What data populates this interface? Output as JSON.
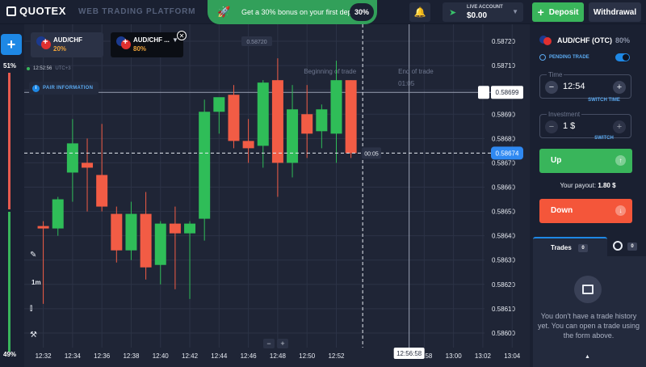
{
  "header": {
    "logo_text": "QUOTEX",
    "platform_title": "WEB TRADING PLATFORM",
    "bonus": {
      "text": "Get a 30% bonus on your first deposit",
      "badge": "30%"
    },
    "account": {
      "label": "LIVE ACCOUNT",
      "balance": "$0.00"
    },
    "deposit_label": "Deposit",
    "withdrawal_label": "Withdrawal"
  },
  "left_rail": {
    "add_label": "+",
    "sentiment_up": "51%",
    "sentiment_down": "49%",
    "sentiment_up_value": 51
  },
  "asset_tabs": [
    {
      "name": "AUD/CHF",
      "payout": "20%"
    },
    {
      "name": "AUD/CHF ...",
      "payout": "80%"
    }
  ],
  "chart_header": {
    "time": "12:52:56",
    "timezone": "UTC+3",
    "pair_info": "PAIR INFORMATION"
  },
  "tools": {
    "timeframe": "1m"
  },
  "zoom": {
    "minus": "−",
    "plus": "+"
  },
  "chart_data": {
    "type": "candlestick",
    "title": "",
    "xlabel": "",
    "ylabel": "",
    "ylim": [
      0.58594,
      0.58727
    ],
    "y_ticks": [
      "0.58720",
      "0.58710",
      "0.58700",
      "0.58690",
      "0.58680",
      "0.58670",
      "0.58660",
      "0.58650",
      "0.58640",
      "0.58630",
      "0.58620",
      "0.58610",
      "0.58600"
    ],
    "x_ticks": [
      "12:32",
      "12:34",
      "12:36",
      "12:38",
      "12:40",
      "12:42",
      "12:44",
      "12:46",
      "12:48",
      "12:50",
      "12:52",
      "12:56:58",
      "12:58",
      "13:00",
      "13:02",
      "13:04"
    ],
    "x_tick_minutes": [
      32,
      34,
      36,
      38,
      40,
      42,
      44,
      46,
      48,
      50,
      52,
      56.97,
      58,
      60,
      62,
      64
    ],
    "candles": [
      {
        "t": 32,
        "o": 0.58644,
        "h": 0.58646,
        "l": 0.58612,
        "c": 0.58643
      },
      {
        "t": 33,
        "o": 0.58643,
        "h": 0.58656,
        "l": 0.5864,
        "c": 0.58655
      },
      {
        "t": 34,
        "o": 0.58666,
        "h": 0.58688,
        "l": 0.58654,
        "c": 0.58678
      },
      {
        "t": 35,
        "o": 0.5867,
        "h": 0.5868,
        "l": 0.5865,
        "c": 0.58668
      },
      {
        "t": 36,
        "o": 0.58665,
        "h": 0.58686,
        "l": 0.5865,
        "c": 0.58652
      },
      {
        "t": 37,
        "o": 0.58649,
        "h": 0.58652,
        "l": 0.58629,
        "c": 0.58634
      },
      {
        "t": 38,
        "o": 0.58634,
        "h": 0.58654,
        "l": 0.5863,
        "c": 0.58649
      },
      {
        "t": 39,
        "o": 0.58649,
        "h": 0.58658,
        "l": 0.58622,
        "c": 0.58627
      },
      {
        "t": 40,
        "o": 0.58628,
        "h": 0.58646,
        "l": 0.5862,
        "c": 0.58645
      },
      {
        "t": 41,
        "o": 0.58645,
        "h": 0.58652,
        "l": 0.58618,
        "c": 0.58641
      },
      {
        "t": 42,
        "o": 0.58641,
        "h": 0.58646,
        "l": 0.58614,
        "c": 0.58645
      },
      {
        "t": 43,
        "o": 0.58647,
        "h": 0.58696,
        "l": 0.58638,
        "c": 0.58691
      },
      {
        "t": 44,
        "o": 0.58691,
        "h": 0.58696,
        "l": 0.58682,
        "c": 0.58697
      },
      {
        "t": 45,
        "o": 0.58698,
        "h": 0.58702,
        "l": 0.58676,
        "c": 0.58679
      },
      {
        "t": 46,
        "o": 0.58679,
        "h": 0.58688,
        "l": 0.5867,
        "c": 0.58676
      },
      {
        "t": 47,
        "o": 0.58677,
        "h": 0.58704,
        "l": 0.58668,
        "c": 0.58703
      },
      {
        "t": 48,
        "o": 0.58704,
        "h": 0.58713,
        "l": 0.58656,
        "c": 0.5867
      },
      {
        "t": 49,
        "o": 0.5867,
        "h": 0.58702,
        "l": 0.58664,
        "c": 0.58692
      },
      {
        "t": 50,
        "o": 0.5869,
        "h": 0.58702,
        "l": 0.58672,
        "c": 0.58682
      },
      {
        "t": 51,
        "o": 0.58683,
        "h": 0.58694,
        "l": 0.58676,
        "c": 0.58692
      },
      {
        "t": 52,
        "o": 0.58682,
        "h": 0.58712,
        "l": 0.5867,
        "c": 0.58704
      },
      {
        "t": 53,
        "o": 0.58704,
        "h": 0.58704,
        "l": 0.58672,
        "c": 0.58674
      }
    ],
    "current_price": "0.58674",
    "current_price_value": 0.58674,
    "strike_price": "0.58699",
    "strike_price_value": 0.58699,
    "hover_price": "0.58720",
    "hover_price_value": 0.5872,
    "countdown": "00:05",
    "beginning_label": "Beginning of trade",
    "end_label": "End of trade",
    "end_time": "01:05",
    "beginning_time_value": 53.8,
    "end_time_value": 56.97,
    "x_range": [
      30.7,
      65.2
    ],
    "colors": {
      "up": "#2fbd58",
      "down": "#f25c45",
      "grid": "#2c3346",
      "price_badge": "#2f89f2"
    }
  },
  "panel": {
    "asset": "AUD/CHF (OTC)",
    "payout_pct": "80%",
    "pending_label": "PENDING TRADE",
    "time_label": "Time",
    "time_value": "12:54",
    "switch_time": "SWITCH TIME",
    "investment_label": "Investment",
    "investment_value": "1 $",
    "switch": "SWITCH",
    "up_label": "Up",
    "payout_label": "Your payout:",
    "payout_value": "1.80 $",
    "down_label": "Down",
    "trades_label": "Trades",
    "trades_count": "0",
    "pending_count": "0",
    "empty_text": "You don't have a trade history yet. You can open a trade using the form above."
  }
}
